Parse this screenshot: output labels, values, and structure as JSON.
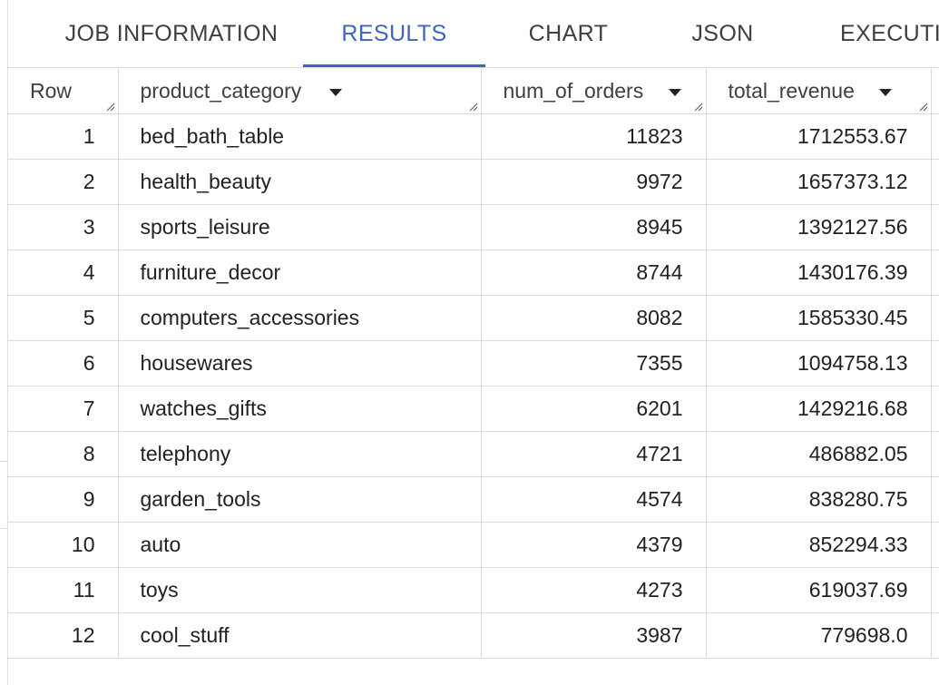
{
  "tabs": [
    {
      "label": "JOB INFORMATION",
      "active": false
    },
    {
      "label": "RESULTS",
      "active": true
    },
    {
      "label": "CHART",
      "active": false
    },
    {
      "label": "JSON",
      "active": false
    },
    {
      "label": "EXECUTIO",
      "active": false
    }
  ],
  "table": {
    "columns": [
      {
        "label": "Row",
        "sortable": false
      },
      {
        "label": "product_category",
        "sortable": true
      },
      {
        "label": "num_of_orders",
        "sortable": true
      },
      {
        "label": "total_revenue",
        "sortable": true
      }
    ],
    "rows": [
      {
        "row": "1",
        "product_category": "bed_bath_table",
        "num_of_orders": "11823",
        "total_revenue": "1712553.67"
      },
      {
        "row": "2",
        "product_category": "health_beauty",
        "num_of_orders": "9972",
        "total_revenue": "1657373.12"
      },
      {
        "row": "3",
        "product_category": "sports_leisure",
        "num_of_orders": "8945",
        "total_revenue": "1392127.56"
      },
      {
        "row": "4",
        "product_category": "furniture_decor",
        "num_of_orders": "8744",
        "total_revenue": "1430176.39"
      },
      {
        "row": "5",
        "product_category": "computers_accessories",
        "num_of_orders": "8082",
        "total_revenue": "1585330.45"
      },
      {
        "row": "6",
        "product_category": "housewares",
        "num_of_orders": "7355",
        "total_revenue": "1094758.13"
      },
      {
        "row": "7",
        "product_category": "watches_gifts",
        "num_of_orders": "6201",
        "total_revenue": "1429216.68"
      },
      {
        "row": "8",
        "product_category": "telephony",
        "num_of_orders": "4721",
        "total_revenue": "486882.05"
      },
      {
        "row": "9",
        "product_category": "garden_tools",
        "num_of_orders": "4574",
        "total_revenue": "838280.75"
      },
      {
        "row": "10",
        "product_category": "auto",
        "num_of_orders": "4379",
        "total_revenue": "852294.33"
      },
      {
        "row": "11",
        "product_category": "toys",
        "num_of_orders": "4273",
        "total_revenue": "619037.69"
      },
      {
        "row": "12",
        "product_category": "cool_stuff",
        "num_of_orders": "3987",
        "total_revenue": "779698.0"
      }
    ]
  },
  "icons": {
    "sort": "sort-down-icon",
    "resize": "column-resize-grip-icon"
  },
  "colors": {
    "accent": "#3c64c4",
    "border": "#dadce0",
    "text": "#202124"
  }
}
